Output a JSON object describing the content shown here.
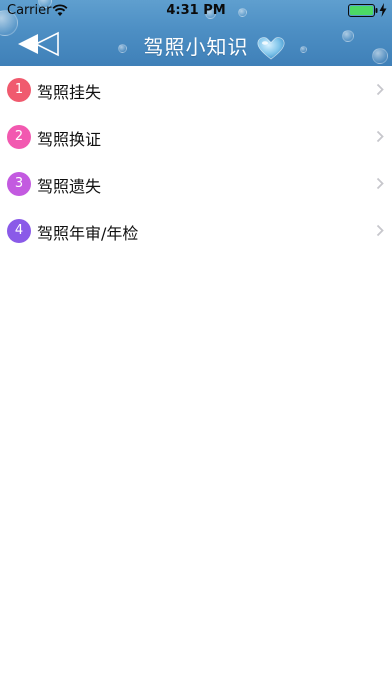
{
  "status_bar": {
    "carrier": "Carrier",
    "time": "4:31 PM"
  },
  "header": {
    "title": "驾照小知识",
    "background_color": "#4d8fc4"
  },
  "list": {
    "items": [
      {
        "number": "1",
        "label": "驾照挂失",
        "badge_color": "#f05a6e"
      },
      {
        "number": "2",
        "label": "驾照换证",
        "badge_color": "#f259b0"
      },
      {
        "number": "3",
        "label": "驾照遗失",
        "badge_color": "#c35ae0"
      },
      {
        "number": "4",
        "label": "驾照年审/年检",
        "badge_color": "#8a5ae8"
      }
    ],
    "chevron_color": "#c7c7cc"
  },
  "icons": {
    "back": "back-arrow-icon",
    "heart": "heart-icon",
    "chevron": "chevron-right-icon",
    "wifi": "wifi-icon",
    "battery": "battery-icon"
  }
}
